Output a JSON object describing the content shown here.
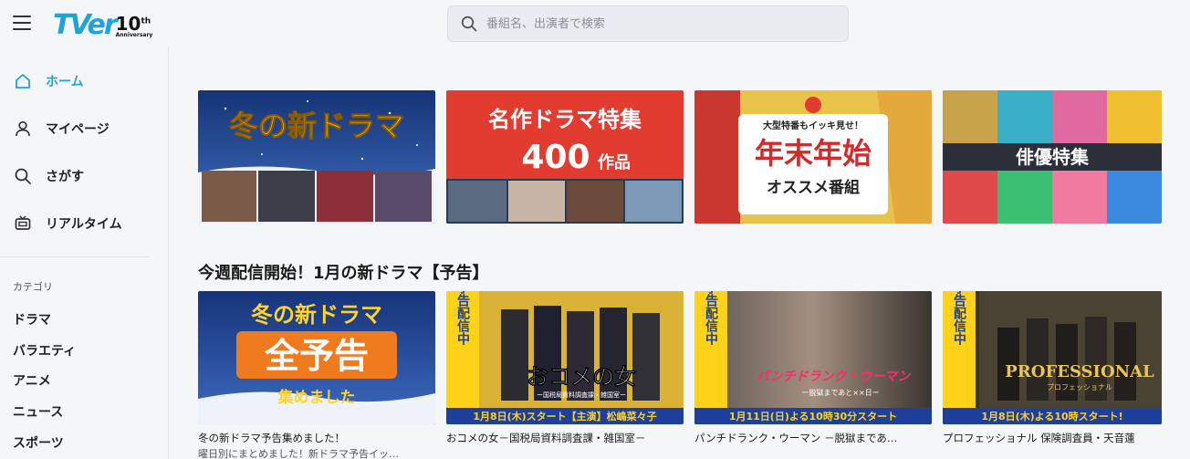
{
  "header": {
    "logo_main": "TVer",
    "logo_num": "10",
    "logo_sup": "th",
    "logo_word": "Anniversary",
    "search_placeholder": "番組名、出演者で検索"
  },
  "sidebar": {
    "items": [
      {
        "label": "ホーム",
        "icon": "home-icon",
        "active": true
      },
      {
        "label": "マイページ",
        "icon": "user-icon",
        "active": false
      },
      {
        "label": "さがす",
        "icon": "search-icon",
        "active": false
      },
      {
        "label": "リアルタイム",
        "icon": "tv-icon",
        "active": false
      }
    ],
    "category_title": "カテゴリ",
    "categories": [
      "ドラマ",
      "バラエティ",
      "アニメ",
      "ニュース",
      "スポーツ"
    ]
  },
  "banners": [
    {
      "text": "冬の新ドラマ"
    },
    {
      "line1": "名作ドラマ特集",
      "line2": "400",
      "line2_suffix": "作品"
    },
    {
      "tag": "大型特番もイッキ見せ！",
      "line1": "年末年始",
      "line2": "オススメ番組"
    },
    {
      "text": "俳優特集"
    }
  ],
  "section": {
    "title": "今週配信開始！1月の新ドラマ【予告】",
    "episodes": [
      {
        "thumb_line1": "冬の新ドラマ",
        "thumb_line2": "全予告",
        "thumb_line3": "集めました",
        "title": "冬の新ドラマ予告集めました！",
        "sub": "曜日別にまとめました！新ドラマ予告イッ…"
      },
      {
        "side": "予告配信中",
        "logo": "おコメの女",
        "logo_sub": "ー国税局資料調査課・雑国室ー",
        "bar": "1月8日(木)スタート【主演】松嶋菜々子",
        "title": "おコメの女－国税局資料調査課・雑国室－",
        "sub": ""
      },
      {
        "side": "予告配信中",
        "logo": "パンチドランク・ウーマン",
        "logo_sub": "ー脱獄まであと××日ー",
        "bar": "1月11日(日)よる10時30分スタート",
        "title": "パンチドランク・ウーマン －脱獄まであ…",
        "sub": ""
      },
      {
        "side": "予告配信中",
        "logo": "PROFESSIONAL",
        "logo_sub": "プロフェッショナル",
        "bar": "1月8日(木)よる10時スタート!",
        "title": "プロフェッショナル 保険調査員・天音蓮",
        "sub": ""
      }
    ]
  },
  "colors": {
    "accent": "#1fa3d8",
    "banner_red": "#e23b30",
    "banner_gold": "#e7c34a",
    "night_blue": "#1b3a7a",
    "bar_blue": "#1e3f9c",
    "side_yellow": "#ffd21a"
  }
}
